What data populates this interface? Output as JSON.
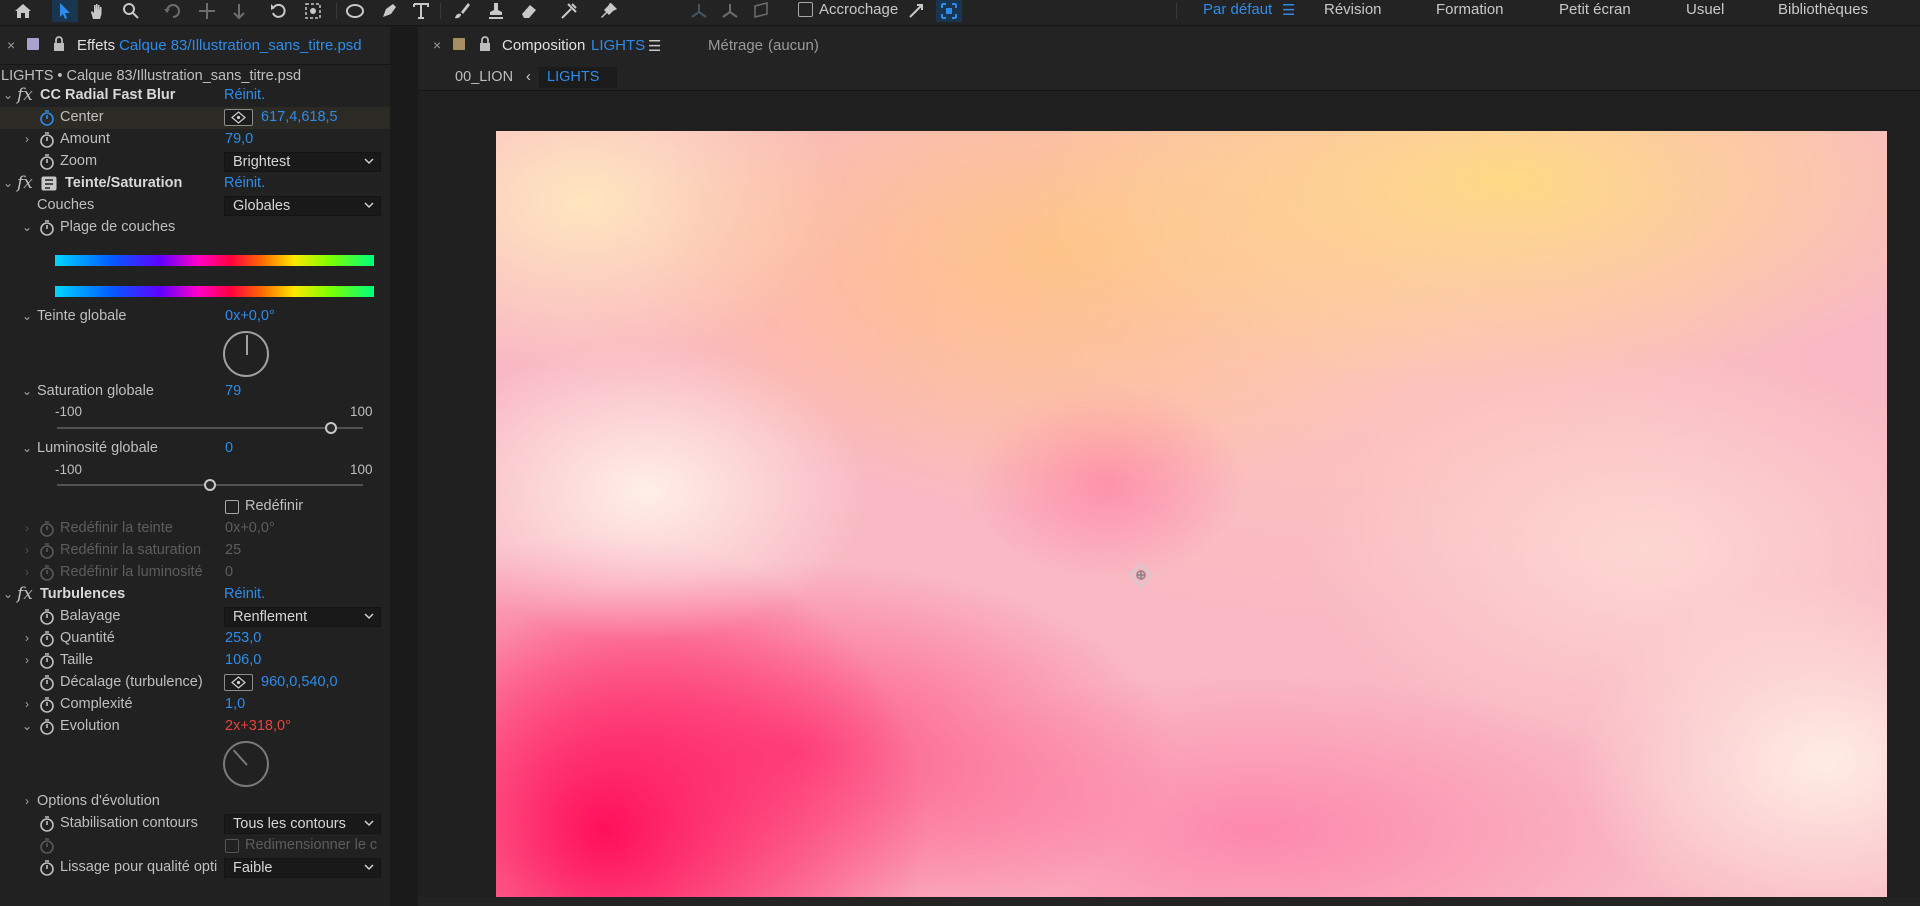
{
  "toolbar": {
    "tools": [
      "home-icon",
      "selection-arrow-icon",
      "hand-icon",
      "zoom-icon",
      "rotate-icon",
      "pan-behind-icon",
      "anchor-icon",
      "undo-rotation-icon",
      "orbit-icon",
      "shape-icon",
      "pen-icon",
      "type-icon",
      "brush-icon",
      "clone-stamp-icon",
      "eraser-icon",
      "roto-brush-icon",
      "puppet-pin-icon"
    ],
    "snapping_label": "Accrochage",
    "workspaces": [
      "Par défaut",
      "Révision",
      "Formation",
      "Petit écran",
      "Usuel",
      "Bibliothèques"
    ],
    "active_workspace": "Par défaut"
  },
  "effects_panel": {
    "tab_label": "Effets",
    "tab_layer": "Calque 83/Illustration_sans_titre.psd",
    "breadcrumb": "LIGHTS • Calque 83/Illustration_sans_titre.psd",
    "reset_label": "Réinit.",
    "radial_blur": {
      "name": "CC Radial Fast Blur",
      "center_label": "Center",
      "center_value": "617,4,618,5",
      "amount_label": "Amount",
      "amount_value": "79,0",
      "zoom_label": "Zoom",
      "zoom_value": "Brightest"
    },
    "hue_sat": {
      "name": "Teinte/Saturation",
      "channels_label": "Couches",
      "channels_value": "Globales",
      "range_label": "Plage de couches",
      "master_hue_label": "Teinte globale",
      "master_hue_value": "0x+0,0°",
      "master_sat_label": "Saturation globale",
      "master_sat_value": "79",
      "master_light_label": "Luminosité globale",
      "master_light_value": "0",
      "slider_min": "-100",
      "slider_max": "100",
      "sat_level": 0.895,
      "light_level": 0.5,
      "colorize_label": "Redéfinir",
      "colorize_hue_label": "Redéfinir la teinte",
      "colorize_hue_value": "0x+0,0°",
      "colorize_sat_label": "Redéfinir la saturation",
      "colorize_sat_value": "25",
      "colorize_light_label": "Redéfinir la luminosité",
      "colorize_light_value": "0"
    },
    "turbulence": {
      "name": "Turbulences",
      "displace_label": "Balayage",
      "displace_value": "Renflement",
      "amount_label": "Quantité",
      "amount_value": "253,0",
      "size_label": "Taille",
      "size_value": "106,0",
      "offset_label": "Décalage (turbulence)",
      "offset_value": "960,0,540,0",
      "complexity_label": "Complexité",
      "complexity_value": "1,0",
      "evolution_label": "Evolution",
      "evolution_value": "2x+318,0°",
      "evolution_options_label": "Options d'évolution",
      "pinning_label": "Stabilisation contours",
      "pinning_value": "Tous les contours",
      "resize_label": "Redimensionner le c",
      "antialias_label": "Lissage pour qualité opti",
      "antialias_value": "Faible"
    }
  },
  "composition_panel": {
    "tab_prefix": "Composition",
    "tab_name": "LIGHTS",
    "footage_label": "Métrage",
    "footage_value": "(aucun)",
    "breadcrumbs": [
      "00_LION",
      "LIGHTS"
    ]
  },
  "colors": {
    "accent_blue": "#2d8ceb",
    "value_red": "#e8423c",
    "panel_bg": "#232323",
    "canvas_pink": "#ff1a5e",
    "canvas_yellow": "#ffdc82"
  }
}
